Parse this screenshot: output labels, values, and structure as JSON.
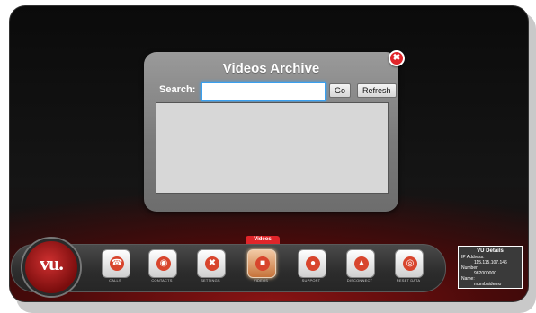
{
  "dialog": {
    "title": "Videos Archive",
    "search_label": "Search:",
    "search_value": "",
    "go_label": "Go",
    "refresh_label": "Refresh",
    "close_glyph": "✖"
  },
  "logo": {
    "text": "vu."
  },
  "dock": {
    "active_tab": "Videos",
    "items": [
      {
        "label": "CALLS",
        "icon": "phone-icon",
        "glyph": "☎"
      },
      {
        "label": "CONTACTS",
        "icon": "contacts-icon",
        "glyph": "◉"
      },
      {
        "label": "SETTINGS",
        "icon": "settings-icon",
        "glyph": "✖"
      },
      {
        "label": "VIDEOS",
        "icon": "video-icon",
        "glyph": "■"
      },
      {
        "label": "SUPPORT",
        "icon": "support-icon",
        "glyph": "●"
      },
      {
        "label": "DISCONNECT",
        "icon": "disconnect-icon",
        "glyph": "▲"
      },
      {
        "label": "RESET DATA",
        "icon": "reset-icon",
        "glyph": "◎"
      }
    ]
  },
  "vu_details": {
    "title": "VU Details",
    "ip_label": "IP Address:",
    "ip_value": "115.115.107.146",
    "number_label": "Number:",
    "number_value": "982000000",
    "name_label": "Name:",
    "name_value": "mumbaidemo"
  },
  "colors": {
    "accent_red": "#e0252a",
    "input_focus": "#3aa0ef",
    "dialog_bg": "#8a8a8a"
  }
}
